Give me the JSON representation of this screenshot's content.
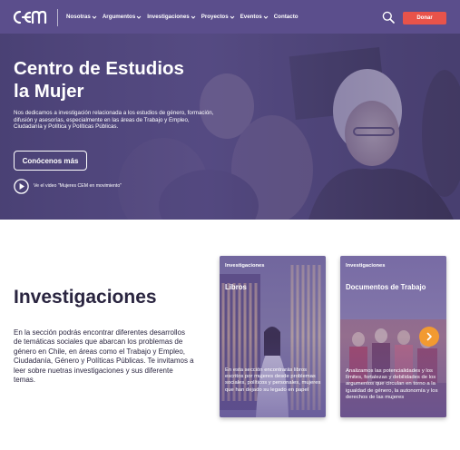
{
  "header": {
    "logo_alt": "cem",
    "nav": [
      {
        "label": "Nosotras",
        "has_dropdown": true
      },
      {
        "label": "Argumentos",
        "has_dropdown": true
      },
      {
        "label": "Investigaciones",
        "has_dropdown": true
      },
      {
        "label": "Proyectos",
        "has_dropdown": true
      },
      {
        "label": "Eventos",
        "has_dropdown": true
      },
      {
        "label": "Contacto",
        "has_dropdown": false
      }
    ],
    "search_icon": "search-icon",
    "donate_label": "Donar"
  },
  "hero": {
    "title_line1": "Centro de Estudios",
    "title_line2": "la Mujer",
    "description": "Nos dedicamos a investigación relacionada a los estudios de género, formación, difusión y asesorías, especialmente en las áreas de Trabajo y Empleo, Ciudadanía y Política y Políticas Públicas.",
    "cta_label": "Conócenos más",
    "video_label": "Ve el video \"Mujeres CEM en movimiento\""
  },
  "investigaciones": {
    "title": "Investigaciones",
    "description": "En la sección podrás encontrar diferentes desarrollos de temáticas sociales que abarcan los problemas de género en Chile, en áreas como el Trabajo y Empleo, Ciudadanía, Género y Políticas Públicas. Te invitamos a leer sobre nuetras investigaciones y sus diferente temas.",
    "cards": [
      {
        "kicker": "Investigaciones",
        "title": "Libros",
        "description": "En esta sección encontrarás libros escritos por mujeres desde problemas sociales, políticos y personales, mujeres que han dejado su legado en papel"
      },
      {
        "kicker": "Investigaciones",
        "title": "Documentos de Trabajo",
        "description": "Analizamos las potencialidades y los límites, fortalezas y debilidades de los argumentos que circulan en torno a la igualdad de género, la autonomía y los derechos de las mujeres"
      }
    ],
    "next_icon": "chevron-right-icon"
  },
  "colors": {
    "header_bg": "#5b4e8c",
    "donate_bg": "#e8534a",
    "arrow_bg": "#f29a31",
    "text_dark": "#2a2540"
  }
}
